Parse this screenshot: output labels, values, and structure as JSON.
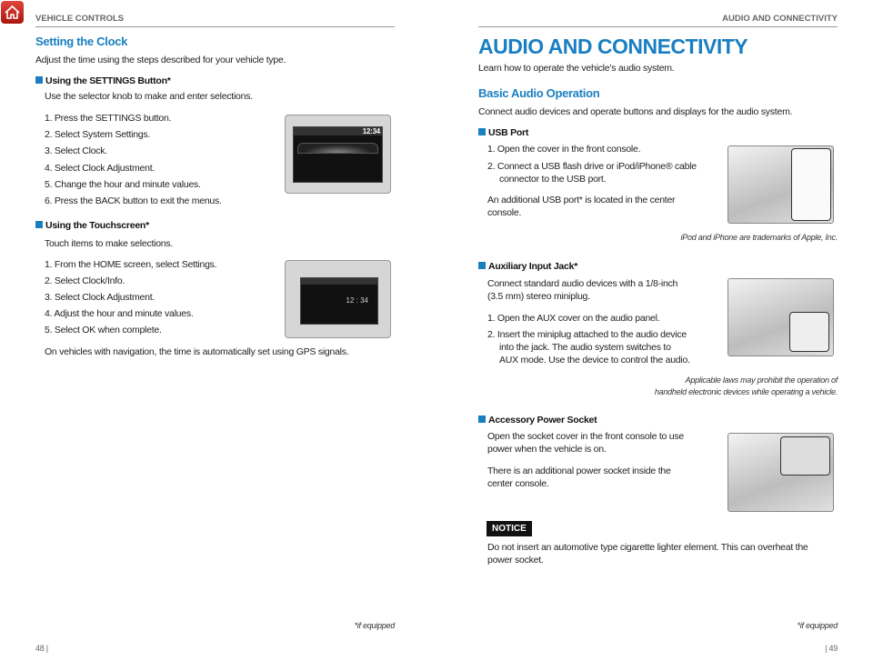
{
  "left": {
    "header": "VEHICLE CONTROLS",
    "title": "Setting the Clock",
    "intro": "Adjust the time using the steps described for your vehicle type.",
    "settings": {
      "heading": "Using the SETTINGS Button*",
      "desc": "Use the selector knob to make and enter selections.",
      "steps": [
        "1. Press the SETTINGS button.",
        "2. Select System Settings.",
        "3. Select Clock.",
        "4. Select Clock Adjustment.",
        "5. Change the hour and minute values.",
        "6. Press the BACK button to exit the menus."
      ],
      "screen_time": "12:34"
    },
    "touch": {
      "heading": "Using the Touchscreen*",
      "desc": "Touch items to make selections.",
      "steps": [
        "1. From the HOME screen, select Settings.",
        "2. Select Clock/Info.",
        "3. Select Clock Adjustment.",
        "4. Adjust the hour and minute values.",
        "5. Select OK when complete."
      ],
      "gps_note": "On vehicles with navigation, the time is automatically set using GPS signals.",
      "screen_time": "12 : 34"
    },
    "footnote": "*if equipped",
    "page": "48  |"
  },
  "right": {
    "header": "AUDIO AND CONNECTIVITY",
    "title": "AUDIO AND CONNECTIVITY",
    "intro": "Learn how to operate the vehicle’s audio system.",
    "basic_title": "Basic Audio Operation",
    "basic_desc": "Connect audio devices and operate buttons and displays for the audio system.",
    "usb": {
      "heading": "USB Port",
      "steps": [
        "1. Open the cover in the front console.",
        "2. Connect a USB flash drive or iPod/iPhone® cable",
        "connector to the USB port."
      ],
      "extra": [
        "An additional USB port* is located in the center",
        "console."
      ],
      "trademark": "iPod and iPhone are trademarks of Apple, Inc."
    },
    "aux": {
      "heading": "Auxiliary Input Jack*",
      "desc": [
        "Connect standard audio devices with a 1/8-inch",
        "(3.5 mm) stereo miniplug."
      ],
      "steps": [
        "1. Open the AUX cover on the audio panel.",
        "2. Insert the miniplug attached to the audio device",
        "into the jack. The audio system switches to",
        "AUX mode. Use the device to control the audio."
      ],
      "law": [
        "Applicable laws may prohibit the operation of",
        "handheld electronic devices while operating a vehicle."
      ]
    },
    "power": {
      "heading": "Accessory Power Socket",
      "desc": [
        "Open the socket cover in the front console to use",
        "power when the vehicle is on."
      ],
      "extra": [
        "There is an additional power socket inside the",
        "center console."
      ]
    },
    "notice": {
      "label": "NOTICE",
      "text": [
        "Do not insert an automotive type cigarette lighter element. This can overheat the",
        "power socket."
      ]
    },
    "footnote": "*if equipped",
    "page": "|  49"
  },
  "colors": {
    "accent": "#1a7fc1",
    "home_icon": "#c0241c"
  },
  "icons": {
    "home": "home-icon"
  }
}
